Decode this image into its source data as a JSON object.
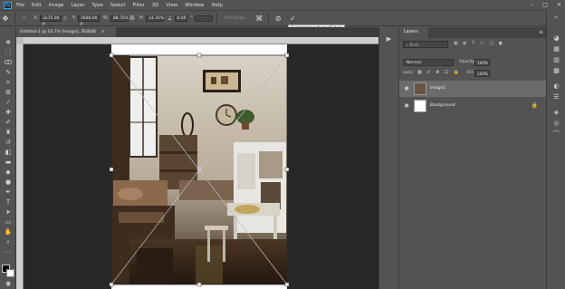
{
  "app": {
    "logo": "Ps"
  },
  "menu": [
    "File",
    "Edit",
    "Image",
    "Layer",
    "Type",
    "Select",
    "Filter",
    "3D",
    "View",
    "Window",
    "Help"
  ],
  "window_controls": [
    "–",
    "□",
    "✕"
  ],
  "options": {
    "x_label": "X:",
    "x_value": "3275.00 p",
    "y_label": "Y:",
    "y_value": "1600.00 p",
    "w_label": "W:",
    "w_value": "88.75%",
    "h_label": "H:",
    "h_value": "31.35%",
    "angle_label": "∠",
    "angle_value": "0.00",
    "h_skew_value": "°",
    "interp_label": "Anti-alias",
    "commit_tooltip": "Commit transform (Enter)"
  },
  "document": {
    "tab_title": "Untitled-1 @ 16.7% (image1, RGB/8)"
  },
  "layers_panel": {
    "tab_label": "Layers",
    "kind_placeholder": "Kind",
    "blend_mode": "Normal",
    "opacity_label": "Opacity:",
    "opacity_value": "100%",
    "lock_label": "Lock:",
    "fill_label": "Fill:",
    "fill_value": "100%",
    "layers": [
      {
        "name": "image1",
        "selected": true
      },
      {
        "name": "Background",
        "selected": false,
        "locked": true
      }
    ]
  },
  "colors": {
    "accent": "#31a8ff",
    "ui_bg": "#535353",
    "canvas_bg": "#282828",
    "selection_row": "#6b6b6b"
  }
}
